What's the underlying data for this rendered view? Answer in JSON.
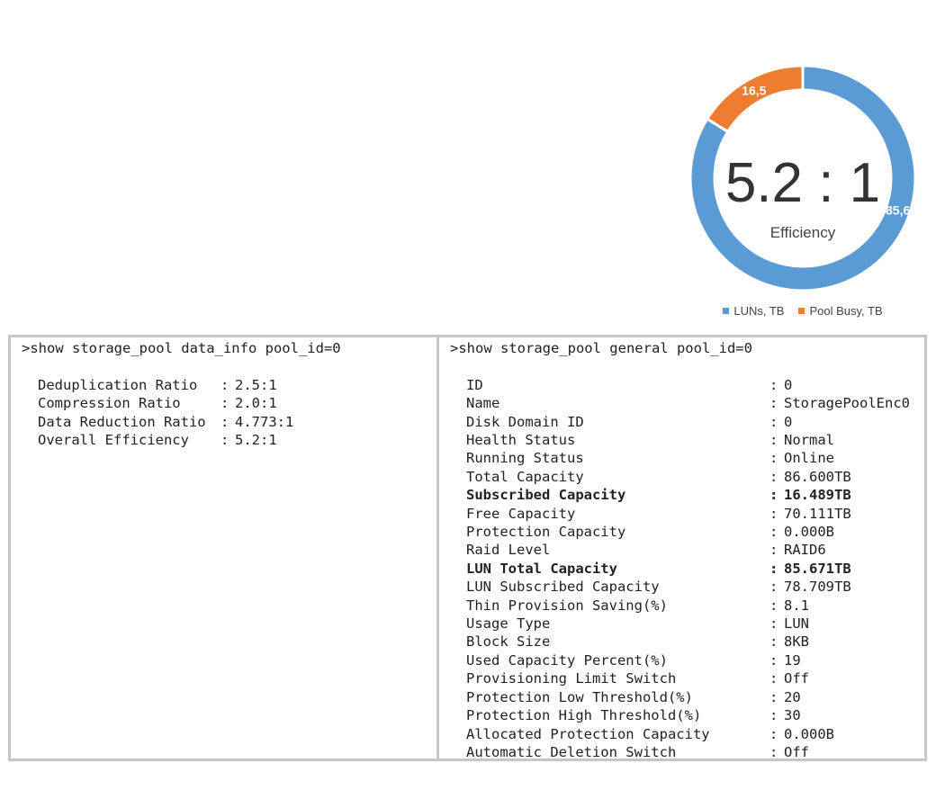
{
  "chart_data": {
    "type": "pie",
    "values": [
      85.6,
      16.5
    ],
    "labels": [
      "85,6",
      "16,5"
    ],
    "legend": [
      "LUNs, TB",
      "Pool Busy, TB"
    ],
    "colors": [
      "#5b9bd5",
      "#ed7d31"
    ],
    "center_value": "5.2 : 1",
    "center_label": "Efficiency",
    "legend_position": "bottom"
  },
  "left_pane": {
    "command": ">show storage_pool data_info pool_id=0",
    "rows": [
      {
        "key": "Deduplication Ratio",
        "sep": ":",
        "value": "2.5:1"
      },
      {
        "key": "Compression Ratio",
        "sep": ":",
        "value": "2.0:1"
      },
      {
        "key": "Data Reduction Ratio",
        "sep": ":",
        "value": "4.773:1"
      },
      {
        "key": "Overall Efficiency",
        "sep": ":",
        "value": "5.2:1"
      }
    ]
  },
  "right_pane": {
    "command": ">show storage_pool general pool_id=0",
    "rows": [
      {
        "key": "ID",
        "sep": ":",
        "value": "0"
      },
      {
        "key": "Name",
        "sep": ":",
        "value": "StoragePoolEnc0"
      },
      {
        "key": "Disk Domain ID",
        "sep": ":",
        "value": "0"
      },
      {
        "key": "Health Status",
        "sep": ":",
        "value": "Normal"
      },
      {
        "key": "Running Status",
        "sep": ":",
        "value": "Online"
      },
      {
        "key": "Total Capacity",
        "sep": ":",
        "value": "86.600TB"
      },
      {
        "key": "Subscribed Capacity",
        "sep": ":",
        "value": "16.489TB",
        "bold": true
      },
      {
        "key": "Free Capacity",
        "sep": ":",
        "value": "70.111TB"
      },
      {
        "key": "Protection Capacity",
        "sep": ":",
        "value": "0.000B"
      },
      {
        "key": "Raid Level",
        "sep": ":",
        "value": "RAID6"
      },
      {
        "key": "LUN Total Capacity",
        "sep": ":",
        "value": "85.671TB",
        "bold": true
      },
      {
        "key": "LUN Subscribed Capacity",
        "sep": ":",
        "value": "78.709TB"
      },
      {
        "key": "Thin Provision Saving(%)",
        "sep": ":",
        "value": "8.1"
      },
      {
        "key": "Usage Type",
        "sep": ":",
        "value": "LUN"
      },
      {
        "key": "Block Size",
        "sep": ":",
        "value": "8KB"
      },
      {
        "key": "Used Capacity Percent(%)",
        "sep": ":",
        "value": "19"
      },
      {
        "key": "Provisioning Limit Switch",
        "sep": ":",
        "value": "Off"
      },
      {
        "key": "Protection Low Threshold(%)",
        "sep": ":",
        "value": "20"
      },
      {
        "key": "Protection High Threshold(%)",
        "sep": ":",
        "value": "30"
      },
      {
        "key": "Allocated Protection Capacity",
        "sep": ":",
        "value": "0.000B"
      },
      {
        "key": "Automatic Deletion Switch",
        "sep": ":",
        "value": "Off"
      }
    ]
  }
}
